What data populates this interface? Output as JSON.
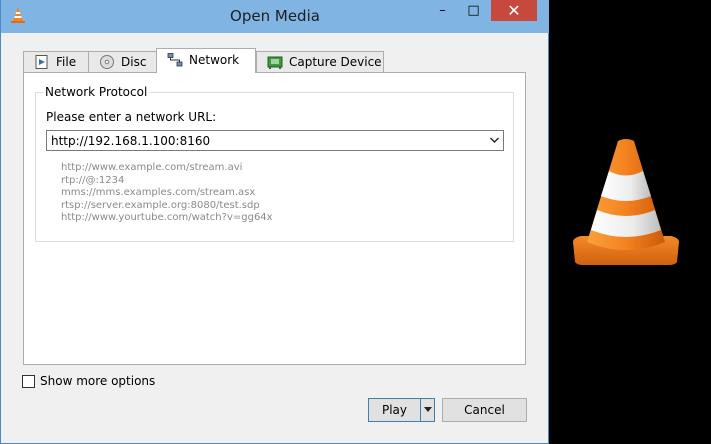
{
  "window": {
    "title": "Open Media"
  },
  "titlebar": {
    "min_glyph": "–",
    "max_glyph": "□",
    "close_glyph": "✕"
  },
  "tabs": [
    {
      "label": "File",
      "icon": "file-icon",
      "active": false
    },
    {
      "label": "Disc",
      "icon": "disc-icon",
      "active": false
    },
    {
      "label": "Network",
      "icon": "network-icon",
      "active": true
    },
    {
      "label": "Capture Device",
      "icon": "capture-device-icon",
      "active": false
    }
  ],
  "network": {
    "group_title": "Network Protocol",
    "url_label": "Please enter a network URL:",
    "url_value": "http://192.168.1.100:8160",
    "examples": [
      "http://www.example.com/stream.avi",
      "rtp://@:1234",
      "mms://mms.examples.com/stream.asx",
      "rtsp://server.example.org:8080/test.sdp",
      "http://www.yourtube.com/watch?v=gg64x"
    ]
  },
  "options": {
    "show_more_label": "Show more options",
    "checked": false
  },
  "buttons": {
    "play": "Play",
    "cancel": "Cancel"
  },
  "colors": {
    "titlebar": "#80b5e3",
    "close_button": "#c7483c",
    "cone_orange": "#f58220",
    "cone_white": "#f2f2f2",
    "background": "#000000"
  }
}
